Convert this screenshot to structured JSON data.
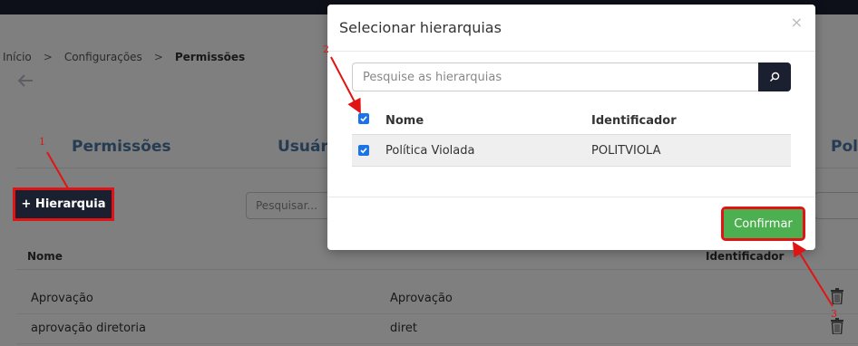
{
  "breadcrumb": {
    "items": [
      "Início",
      "Configurações",
      "Permissões"
    ],
    "separator": ">"
  },
  "tabs": [
    "Permissões",
    "Usuári",
    "Polí"
  ],
  "toolbar": {
    "add_hierarchy_label": "+ Hierarquia",
    "search_placeholder": "Pesquisar..."
  },
  "background_table": {
    "columns": [
      "Nome",
      "Identificador"
    ],
    "rows": [
      {
        "nome": "Aprovação",
        "identificador": "Aprovação"
      },
      {
        "nome": "aprovação diretoria",
        "identificador": "diret"
      }
    ]
  },
  "modal": {
    "title": "Selecionar hierarquias",
    "close": "×",
    "search_placeholder": "Pesquise as hierarquias",
    "columns": [
      "Nome",
      "Identificador"
    ],
    "rows": [
      {
        "nome": "Política Violada",
        "identificador": "POLITVIOLA",
        "checked": true
      }
    ],
    "select_all_checked": true,
    "confirm_label": "Confirmar"
  },
  "annotations": [
    "1",
    "2",
    "3"
  ],
  "colors": {
    "dark": "#1b2030",
    "accent_blue": "#4a78a6",
    "confirm_green": "#4caf50",
    "annotation_red": "#e01414",
    "checkbox_blue": "#1a73e8"
  }
}
